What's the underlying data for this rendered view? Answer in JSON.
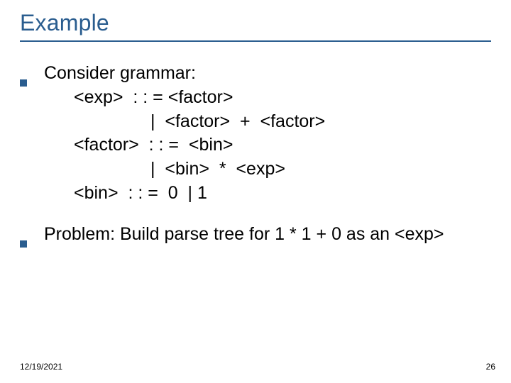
{
  "title": "Example",
  "items": [
    {
      "lead": "Consider grammar:",
      "grammar": [
        {
          "cls": "indent1",
          "text": "<exp>  : : = <factor>"
        },
        {
          "cls": "indent2",
          "text": "|  <factor>  +  <factor>"
        },
        {
          "cls": "indent1",
          "text": "<factor>  : : =  <bin>"
        },
        {
          "cls": "indent2",
          "text": "|  <bin>  *  <exp>"
        },
        {
          "cls": "indent1",
          "text": "<bin>  : : =  0  | 1"
        }
      ]
    },
    {
      "lead": "Problem: Build parse tree for  1 * 1 + 0 as an <exp>",
      "grammar": []
    }
  ],
  "footer_date": "12/19/2021",
  "page_number": "26"
}
